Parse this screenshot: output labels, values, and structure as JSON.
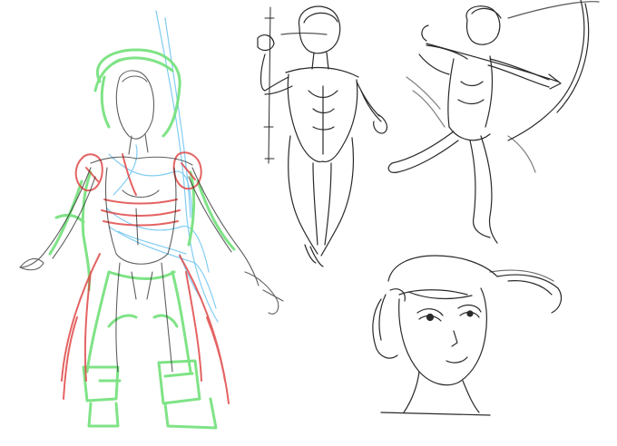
{
  "image": {
    "kind": "sketch-sheet",
    "background_color": "#ffffff",
    "ink_colors": {
      "graphite": "#2a2a2a",
      "graphite_light": "#7a7a7a",
      "green": "#72e07a",
      "red": "#e04848",
      "blue": "#6cc4f0"
    },
    "figures": [
      {
        "id": "costume-study",
        "inks": [
          "graphite",
          "green",
          "red",
          "blue"
        ]
      },
      {
        "id": "standing-pose",
        "inks": [
          "graphite"
        ]
      },
      {
        "id": "archer-pose",
        "inks": [
          "graphite"
        ]
      },
      {
        "id": "portrait-head",
        "inks": [
          "graphite"
        ]
      }
    ]
  }
}
